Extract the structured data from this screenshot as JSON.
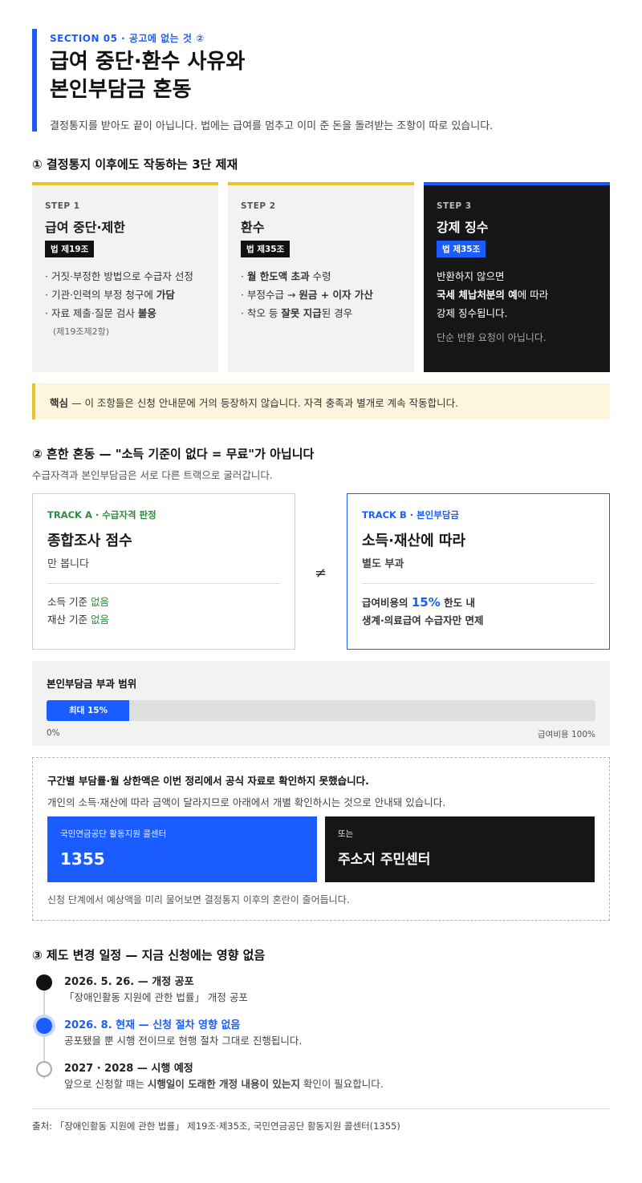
{
  "header": {
    "section_label": "SECTION 05 · 공고에 없는 것 ②",
    "title_line1": "급여 중단·환수 사유와",
    "title_line2": "본인부담금 혼동",
    "subtitle": "결정통지를 받아도 끝이 아닙니다. 법에는 급여를 멈추고 이미 준 돈을 돌려받는 조항이 따로 있습니다."
  },
  "section1": {
    "heading": "① 결정통지 이후에도 작동하는 3단 제재",
    "steps": [
      {
        "no": "STEP 1",
        "title": "급여 중단·제한",
        "law": "법 제19조",
        "items": [
          "· 거짓·부정한 방법으로 수급자 선정",
          "· 기관·인력의 부정 청구에 ",
          "가담",
          "· 자료 제출·질문 검사 ",
          "불응"
        ],
        "note": "(제19조제2항)"
      },
      {
        "no": "STEP 2",
        "title": "환수",
        "law": "법 제35조",
        "items": [
          "· ",
          "월 한도액 초과",
          " 수령",
          "· 부정수급 → ",
          "원금 + 이자 가산",
          "· 착오 등 ",
          "잘못 지급",
          "된 경우"
        ]
      },
      {
        "no": "STEP 3",
        "title": "강제 징수",
        "law": "법 제35조",
        "body1": "반환하지 않으면",
        "body2_b": "국세 체납처분의 예",
        "body2": "에 따라",
        "body3": "강제 징수됩니다.",
        "note": "단순 반환 요청이 아닙니다."
      }
    ],
    "callout_label": "핵심",
    "callout_text": " — 이 조항들은 신청 안내문에 거의 등장하지 않습니다. 자격 충족과 별개로 계속 작동합니다."
  },
  "section2": {
    "heading": "② 흔한 혼동 — \"소득 기준이 없다 = 무료\"가 아닙니다",
    "sub": "수급자격과 본인부담금은 서로 다른 트랙으로 굴러갑니다.",
    "track_a": {
      "label": "TRACK A · 수급자격 판정",
      "title": "종합조사 점수",
      "sub": "만 봅니다",
      "line1": "소득 기준 ",
      "line1_v": "없음",
      "line2": "재산 기준 ",
      "line2_v": "없음"
    },
    "neq": "≠",
    "track_b": {
      "label": "TRACK B · 본인부담금",
      "title": "소득·재산에 따라",
      "sub": "별도 부과",
      "line1": "급여비용의 ",
      "line1_v": "15%",
      "line1_end": " 한도 내",
      "line2": "생계·의료급여 수급자만 면제"
    },
    "range": {
      "title": "본인부담금 부과 범위",
      "fill_label": "최대 15%",
      "fill_percent": 15,
      "axis_left": "0%",
      "axis_right": "급여비용 100%"
    },
    "info": {
      "heading": "구간별 부담률·월 상한액은 이번 정리에서 공식 자료로 확인하지 못했습니다.",
      "text": "개인의 소득·재산에 따라 금액이 달라지므로 아래에서 개별 확인하시는 것으로 안내돼 있습니다.",
      "contact1_small": "국민연금공단 활동지원 콜센터",
      "contact1_big": "1355",
      "contact2_small": "또는",
      "contact2_big": "주소지 주민센터",
      "foot": "신청 단계에서 예상액을 미리 물어보면 결정통지 이후의 혼란이 줄어듭니다."
    }
  },
  "section3": {
    "heading": "③ 제도 변경 일정 — 지금 신청에는 영향 없음",
    "items": [
      {
        "title": "2026. 5. 26. — 개정 공포",
        "desc": "「장애인활동 지원에 관한 법률」 개정 공포"
      },
      {
        "title": "2026. 8. 현재 — 신청 절차 영향 없음",
        "desc": "공포됐을 뿐 시행 전이므로 현행 절차 그대로 진행됩니다."
      },
      {
        "title": "2027 · 2028 — 시행 예정",
        "desc_a": "앞으로 신청할 때는 ",
        "desc_b": "시행일이 도래한 개정 내용이 있는지",
        "desc_c": " 확인이 필요합니다."
      }
    ]
  },
  "source": "출처: 「장애인활동 지원에 관한 법률」 제19조·제35조, 국민연금공단 활동지원 콜센터(1355)",
  "colors": {
    "accent_blue": "#1a5cff",
    "accent_yellow": "#e8c32e",
    "accent_green": "#2e8b3e",
    "dark": "#161616"
  }
}
